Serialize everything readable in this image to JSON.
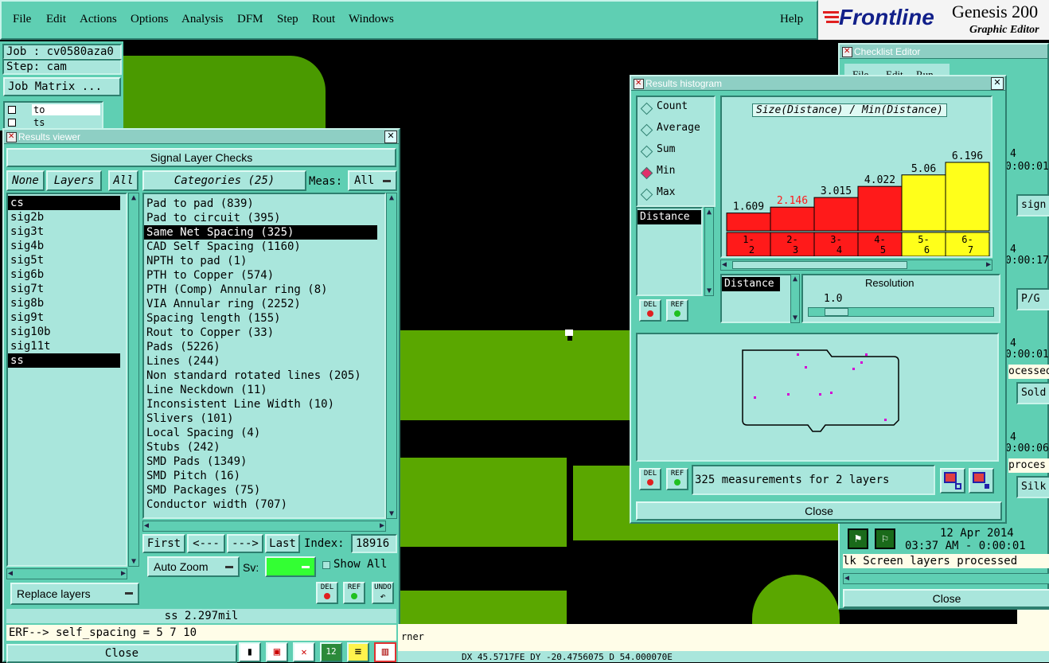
{
  "menubar": {
    "items": [
      "File",
      "Edit",
      "Actions",
      "Options",
      "Analysis",
      "DFM",
      "Step",
      "Rout",
      "Windows"
    ],
    "help": "Help"
  },
  "brand": {
    "logo": "Frontline",
    "product": "Genesis 200",
    "subtitle": "Graphic Editor"
  },
  "job_panel": {
    "job": "Job : cv0580aza0",
    "step": "Step: cam",
    "job_matrix": "Job Matrix ...",
    "rows": [
      "to",
      "ts"
    ]
  },
  "results_viewer": {
    "title": "Results viewer",
    "header": "Signal Layer Checks",
    "none_btn": "None",
    "layers_btn": "Layers",
    "all_btn": "All",
    "categories_btn": "Categories (25)",
    "meas_label": "Meas:",
    "meas_value": "All",
    "layers": [
      "cs",
      "sig2b",
      "sig3t",
      "sig4b",
      "sig5t",
      "sig6b",
      "sig7t",
      "sig8b",
      "sig9t",
      "sig10b",
      "sig11t",
      "ss"
    ],
    "categories": [
      "Pad to pad (839)",
      "Pad to circuit (395)",
      "Same Net Spacing (325)",
      "CAD Self Spacing (1160)",
      "NPTH to pad (1)",
      "PTH to Copper (574)",
      "PTH (Comp) Annular ring (8)",
      "VIA Annular ring (2252)",
      "Spacing length (155)",
      "Rout to Copper (33)",
      "Pads (5226)",
      "Lines (244)",
      "Non standard rotated lines (205)",
      "Line Neckdown (11)",
      "Inconsistent Line Width (10)",
      "Slivers (101)",
      "Local Spacing (4)",
      "Stubs (242)",
      "SMD Pads (1349)",
      "SMD Pitch (16)",
      "SMD Packages (75)",
      "Conductor width (707)"
    ],
    "first_btn": "First",
    "prev_btn": "<---",
    "next_btn": "--->",
    "last_btn": "Last",
    "index_label": "Index:",
    "index_value": "18916",
    "auto_zoom": "Auto Zoom",
    "sv_label": "Sv:",
    "show_all": "Show All",
    "replace_layers": "Replace layers",
    "del": "DEL",
    "ref": "REF",
    "undo": "UNDO",
    "status": "ss 2.297mil",
    "erf": "ERF--> self_spacing = 5 7 10",
    "close": "Close"
  },
  "histogram": {
    "title": "Results histogram",
    "modes": [
      "Count",
      "Average",
      "Sum",
      "Min",
      "Max"
    ],
    "selected_mode": "Min",
    "attribute": "Distance",
    "chart_title": "Size(Distance) / Min(Distance)",
    "resolution_label": "Resolution",
    "resolution_value": "1.0",
    "distance_label": "Distance",
    "measurements": "325 measurements for 2 layers",
    "close": "Close",
    "del": "DEL",
    "ref": "REF"
  },
  "chart_data": {
    "type": "bar",
    "title": "Size(Distance) / Min(Distance)",
    "categories": [
      "1-2",
      "2-3",
      "3-4",
      "4-5",
      "5-6",
      "6-7"
    ],
    "values": [
      1.609,
      2.146,
      3.015,
      4.022,
      5.06,
      6.196
    ],
    "value_labels": [
      "1.609",
      "2.146",
      "3.015",
      "4.022",
      "5.06",
      "6.196"
    ],
    "colors": [
      "#ff1a1a",
      "#ff1a1a",
      "#ff1a1a",
      "#ff1a1a",
      "#ffff1a",
      "#ffff1a"
    ],
    "highlight_index": 1,
    "ylim": [
      0,
      7
    ]
  },
  "checklist": {
    "title": "Checklist Editor",
    "menu": [
      "File",
      "Edit",
      "Run"
    ],
    "rows": [
      {
        "num": "4",
        "time": "0:00:01",
        "name": "sign"
      },
      {
        "num": "4",
        "time": "0:00:17",
        "name": "P/G"
      },
      {
        "num": "4",
        "time": "0:00:01",
        "name": "Sold",
        "status": "ocessed"
      },
      {
        "num": "4",
        "time": "0:00:06",
        "name": "Silk",
        "status": "proces"
      }
    ],
    "date": "12 Apr 2014",
    "time": "03:37 AM - 0:00:01",
    "status_line": "lk Screen layers processed",
    "close": "Close"
  },
  "bottom": {
    "status_fragment": "rner",
    "coords": "DX 45.5717FE DY -20.4756075 D 54.000070E"
  },
  "colors": {
    "teal": "#5fcfb3",
    "pale": "#a9e6dc",
    "copper": "#4a9a00",
    "red": "#ff1a1a",
    "yellow": "#ffff1a"
  }
}
